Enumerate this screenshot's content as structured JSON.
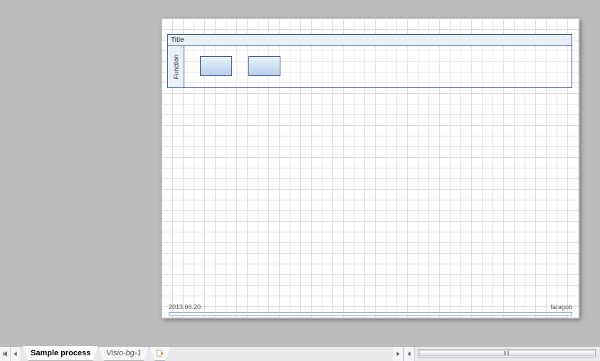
{
  "canvas": {
    "swimlane": {
      "title": "Title",
      "lane_label": "Function"
    },
    "footer_date": "2013.06.20.",
    "footer_author": "faragob"
  },
  "tabs": {
    "items": [
      {
        "label": "Sample process",
        "active": true
      },
      {
        "label": "Visio-bg-1",
        "active": false
      }
    ]
  }
}
